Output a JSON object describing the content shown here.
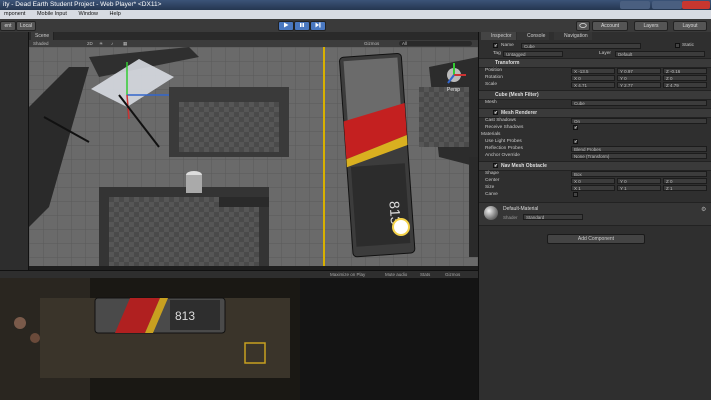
{
  "title_bar": {
    "title": "ity - Dead Earth Student Project - Web Player* <DX11>"
  },
  "menubar": {
    "items": [
      "mponent",
      "Mobile Input",
      "Window",
      "Help"
    ]
  },
  "toolbar": {
    "account": "Account",
    "layers": "Layers",
    "layout": "Layout",
    "left_btn_1": "ent",
    "left_btn_2": "Local"
  },
  "scene": {
    "tab": "Scene",
    "shading": "Shaded",
    "mode": "2D",
    "gizmos": "Gizmos",
    "search": "All",
    "persp_label": "Persp",
    "train_number": "813"
  },
  "game": {
    "bar_items": [
      "Maximize on Play",
      "Mute audio",
      "Stats",
      "Gizmos"
    ],
    "train_number": "813"
  },
  "inspector": {
    "tabs": [
      "Inspector",
      "Console",
      "Navigation"
    ],
    "object": {
      "name_label": "Name",
      "name": "Cube",
      "static": "Static",
      "tag_label": "Tag",
      "tag": "Untagged",
      "layer_label": "Layer",
      "layer": "Default"
    },
    "transform": {
      "header": "Transform",
      "rows": [
        {
          "label": "Position",
          "x": "X -13.5",
          "y": "Y 0.97",
          "z": "Z -0.16"
        },
        {
          "label": "Rotation",
          "x": "X 0",
          "y": "Y 0",
          "z": "Z 0"
        },
        {
          "label": "Scale",
          "x": "X 4.71",
          "y": "Y 2.77",
          "z": "Z 4.79"
        }
      ]
    },
    "mesh_filter": {
      "header": "Cube (Mesh Filter)",
      "mesh_label": "Mesh",
      "mesh": "Cube"
    },
    "mesh_renderer": {
      "header": "Mesh Renderer",
      "cast_shadows_label": "Cast Shadows",
      "cast_shadows": "On",
      "receive_shadows_label": "Receive Shadows",
      "materials_label": "Materials",
      "use_light_probes_label": "Use Light Probes",
      "reflection_probes_label": "Reflection Probes",
      "reflection_probes": "Blend Probes",
      "anchor_override_label": "Anchor Override",
      "anchor_override": "None (Transform)"
    },
    "nav_mesh_obstacle": {
      "header": "Nav Mesh Obstacle",
      "shape_label": "Shape",
      "shape": "Box",
      "center_label": "Center",
      "center": {
        "x": "X 0",
        "y": "Y 0",
        "z": "Z 0"
      },
      "size_label": "Size",
      "size": {
        "x": "X 1",
        "y": "Y 1",
        "z": "Z 1"
      },
      "carve_label": "Carve"
    },
    "material": {
      "name": "Default-Material",
      "shader_label": "Shader",
      "shader": "Standard"
    },
    "add_component": "Add Component"
  }
}
